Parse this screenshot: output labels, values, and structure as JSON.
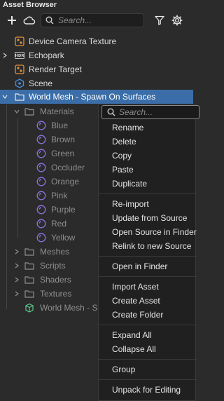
{
  "panel": {
    "title": "Asset Browser"
  },
  "search": {
    "placeholder": "Search..."
  },
  "tree": {
    "device_camera_texture": "Device Camera Texture",
    "echopark": "Echopark",
    "render_target": "Render Target",
    "scene": "Scene",
    "world_mesh": "World Mesh - Spawn On Surfaces",
    "materials": "Materials",
    "material_items": [
      "Blue",
      "Brown",
      "Green",
      "Occluder",
      "Orange",
      "Pink",
      "Purple",
      "Red",
      "Yellow"
    ],
    "meshes": "Meshes",
    "scripts": "Scripts",
    "shaders": "Shaders",
    "textures": "Textures",
    "world_mesh_prefab": "World Mesh - Sp"
  },
  "context_menu": {
    "search_placeholder": "Search...",
    "rename": "Rename",
    "delete": "Delete",
    "copy": "Copy",
    "paste": "Paste",
    "duplicate": "Duplicate",
    "reimport": "Re-import",
    "update_from_source": "Update from Source",
    "open_source_in_finder": "Open Source in Finder",
    "relink_to_new_source": "Relink to new Source",
    "open_in_finder": "Open in Finder",
    "import_asset": "Import Asset",
    "create_asset": "Create Asset",
    "create_folder": "Create Folder",
    "expand_all": "Expand All",
    "collapse_all": "Collapse All",
    "group": "Group",
    "unpack_for_editing": "Unpack for Editing"
  },
  "colors": {
    "selection": "#3b6ea8",
    "texture_icon": "#e0913a",
    "scene_icon": "#4a8fe0",
    "material_icon": "#8e72e0",
    "prefab_icon": "#5ec98a"
  },
  "icons": {
    "add": "plus-icon",
    "cloud": "cloud-icon",
    "search": "search-icon",
    "filter": "filter-icon",
    "settings": "gear-icon"
  }
}
